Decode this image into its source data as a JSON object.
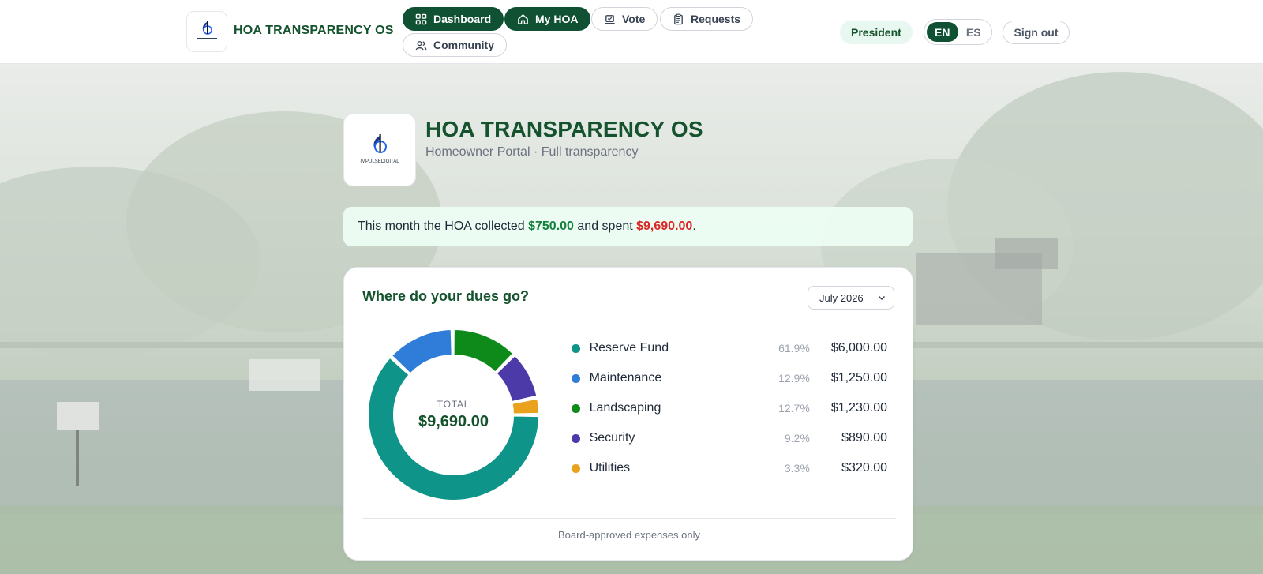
{
  "header": {
    "brand": "HOA TRANSPARENCY OS",
    "nav": [
      {
        "label": "Dashboard",
        "icon": "dashboard-icon",
        "active": true
      },
      {
        "label": "My HOA",
        "icon": "home-icon",
        "active": true
      },
      {
        "label": "Vote",
        "icon": "vote-icon",
        "active": false
      },
      {
        "label": "Requests",
        "icon": "clipboard-icon",
        "active": false
      },
      {
        "label": "Community",
        "icon": "users-icon",
        "active": false
      }
    ],
    "role": "President",
    "languages": [
      "EN",
      "ES"
    ],
    "selected_language": "EN",
    "sign_out": "Sign out"
  },
  "hero": {
    "logo_text": "IMPULSEDIGITAL",
    "title": "HOA TRANSPARENCY OS",
    "subtitle": "Homeowner Portal · Full transparency"
  },
  "summary": {
    "prefix": "This month the HOA collected ",
    "collected": "$750.00",
    "middle": " and spent ",
    "spent": "$9,690.00",
    "suffix": "."
  },
  "card": {
    "title": "Where do your dues go?",
    "month": "July 2026",
    "total_label": "TOTAL",
    "total": "$9,690.00",
    "footer": "Board-approved expenses only"
  },
  "chart_data": {
    "type": "pie",
    "categories": [
      "Reserve Fund",
      "Maintenance",
      "Landscaping",
      "Security",
      "Utilities"
    ],
    "values": [
      6000,
      1250,
      1230,
      890,
      320
    ],
    "percent_labels": [
      "61.9%",
      "12.9%",
      "12.7%",
      "9.2%",
      "3.3%"
    ],
    "amount_labels": [
      "$6,000.00",
      "$1,250.00",
      "$1,230.00",
      "$890.00",
      "$320.00"
    ],
    "colors": [
      "#0e9488",
      "#2f7dd8",
      "#0d8a1a",
      "#4b3aa8",
      "#eaa21c"
    ]
  }
}
